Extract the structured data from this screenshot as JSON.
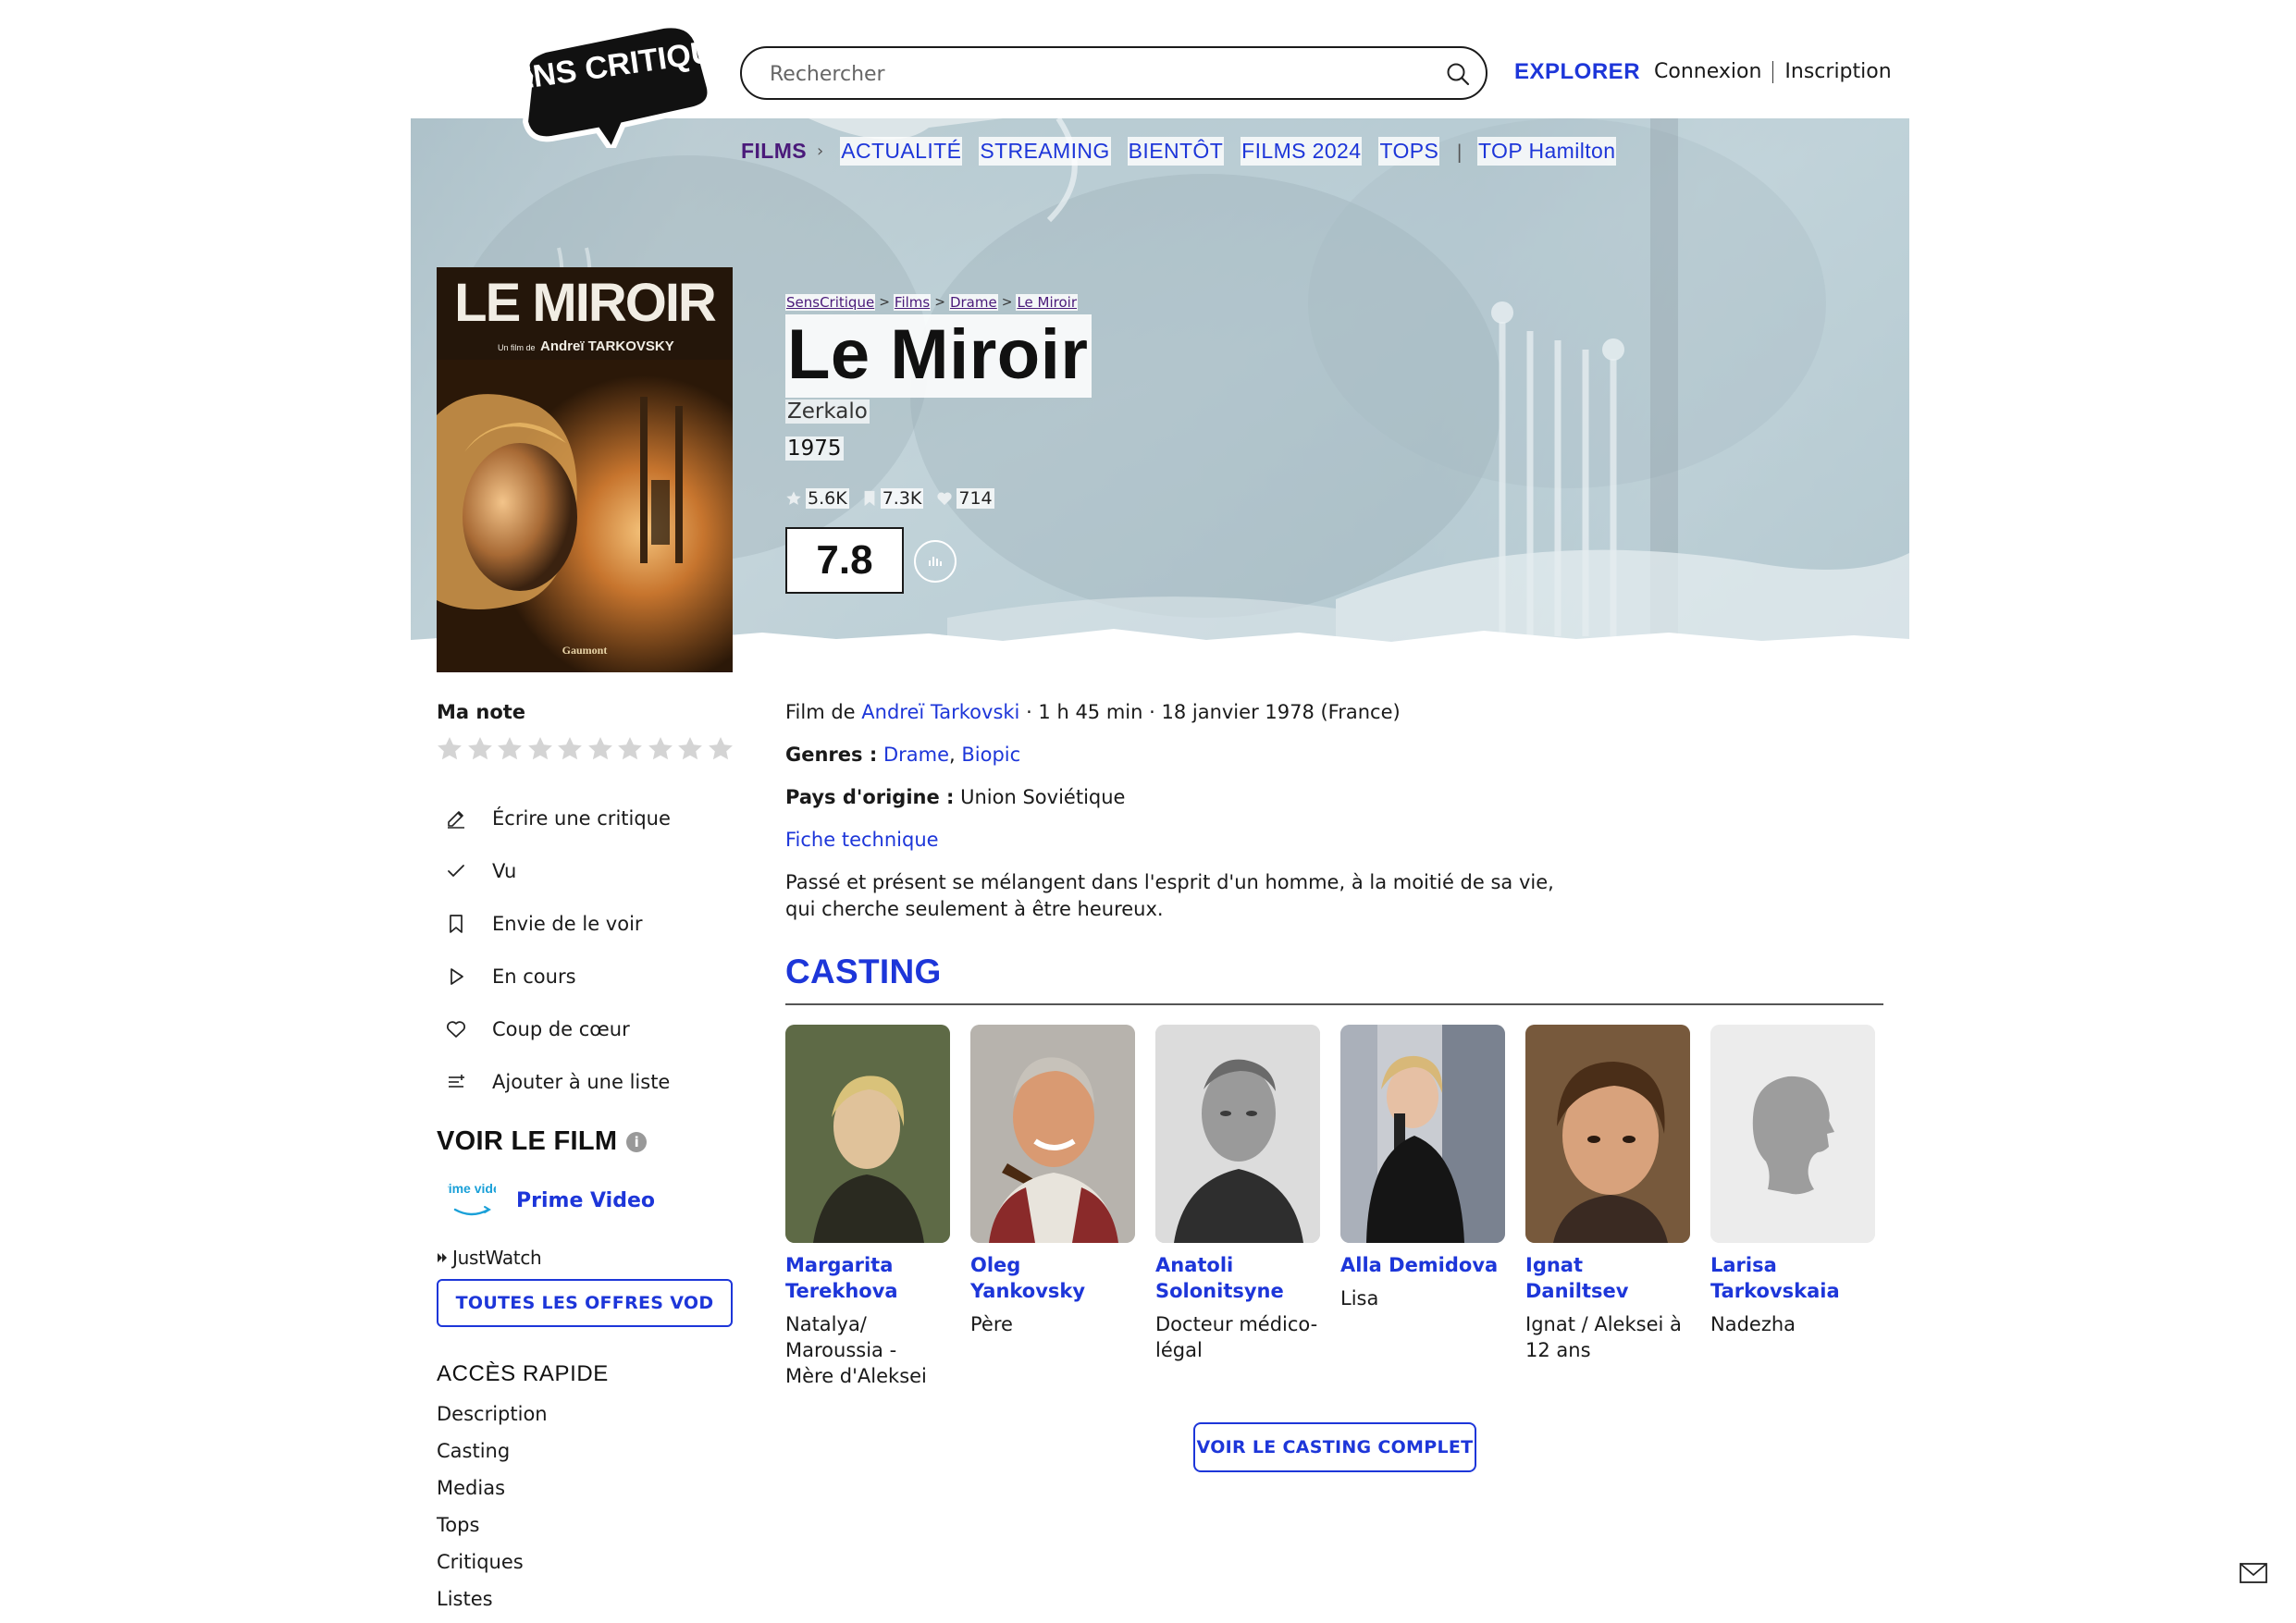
{
  "header": {
    "logo_text": "SENS CRITIQUE",
    "search_placeholder": "Rechercher",
    "explorer_label": "EXPLORER",
    "login_label": "Connexion",
    "signup_label": "Inscription"
  },
  "subnav": {
    "films_label": "FILMS",
    "items": [
      "ACTUALITÉ",
      "STREAMING",
      "BIENTÔT",
      "FILMS 2024",
      "TOPS",
      "TOP Hamilton"
    ]
  },
  "breadcrumb": [
    "SensCritique",
    "Films",
    "Drame",
    "Le Miroir"
  ],
  "film": {
    "title": "Le Miroir",
    "original_title": "Zerkalo",
    "year": "1975",
    "rating_count": "5.6K",
    "wish_count": "7.3K",
    "favorite_count": "714",
    "score": "7.8",
    "poster_title": "LE MIROIR",
    "poster_credit_prefix": "Un film de",
    "poster_credit_name": "Andreï TARKOVSKY",
    "poster_studio": "Gaumont",
    "meta_prefix": "Film de",
    "director": "Andreï Tarkovski",
    "meta_suffix": "· 1 h 45 min · 18 janvier 1978 (France)",
    "genres_label": "Genres :",
    "genre_1": "Drame",
    "genre_sep": ",",
    "genre_2": "Biopic",
    "country_label": "Pays d'origine :",
    "country": "Union Soviétique",
    "fiche_label": "Fiche technique",
    "synopsis": "Passé et présent se mélangent dans l'esprit d'un homme, à la moitié de sa vie, qui cherche seulement à être heureux."
  },
  "sidebar": {
    "my_rating_label": "Ma note",
    "star_count": 10,
    "actions": [
      {
        "label": "Écrire une critique",
        "icon": "pencil-icon"
      },
      {
        "label": "Vu",
        "icon": "check-icon"
      },
      {
        "label": "Envie de le voir",
        "icon": "bookmark-icon"
      },
      {
        "label": "En cours",
        "icon": "play-icon"
      },
      {
        "label": "Coup de cœur",
        "icon": "heart-icon"
      },
      {
        "label": "Ajouter à une liste",
        "icon": "list-add-icon"
      }
    ],
    "watch_title": "VOIR LE FILM",
    "watch_info": "i",
    "provider_logo_text": "prime video",
    "provider_name": "Prime Video",
    "justwatch_label": "JustWatch",
    "vod_button": "TOUTES LES OFFRES VOD",
    "quick_access_title": "ACCÈS RAPIDE",
    "quick_links": [
      "Description",
      "Casting",
      "Medias",
      "Tops",
      "Critiques",
      "Listes"
    ]
  },
  "casting": {
    "title": "CASTING",
    "members": [
      {
        "name": "Margarita Terekhova",
        "role": "Natalya/ Maroussia - Mère d'Aleksei"
      },
      {
        "name": "Oleg Yankovsky",
        "role": "Père"
      },
      {
        "name": "Anatoli Solonitsyne",
        "role": "Docteur médico-légal"
      },
      {
        "name": "Alla Demidova",
        "role": "Lisa"
      },
      {
        "name": "Ignat Daniltsev",
        "role": "Ignat / Aleksei à 12 ans"
      },
      {
        "name": "Larisa Tarkovskaia",
        "role": "Nadezha"
      }
    ],
    "full_cast_button": "VOIR LE CASTING COMPLET"
  },
  "colors": {
    "accent": "#1d36d9",
    "films_purple": "#4a1a7a",
    "text": "#1a1a1a"
  }
}
